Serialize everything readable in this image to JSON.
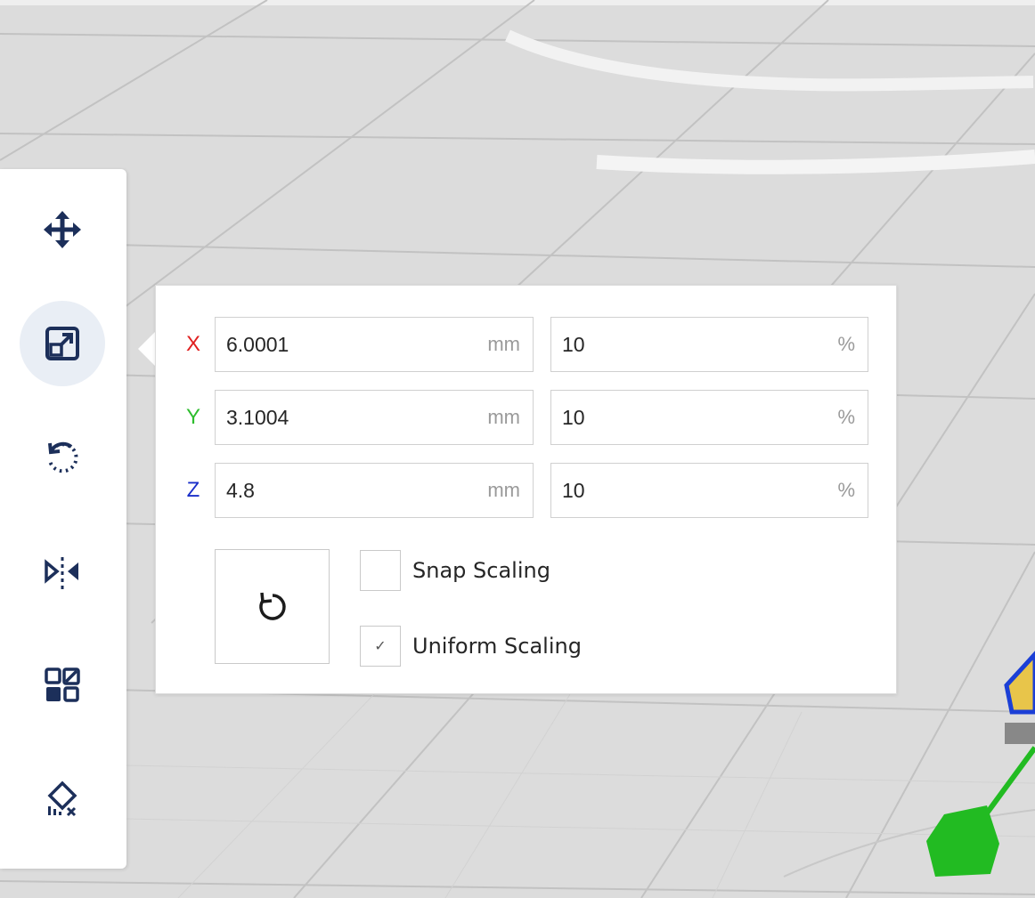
{
  "toolbar": {
    "tools": [
      {
        "name": "move",
        "icon": "move-icon"
      },
      {
        "name": "scale",
        "icon": "scale-icon",
        "active": true
      },
      {
        "name": "rotate",
        "icon": "rotate-icon"
      },
      {
        "name": "mirror",
        "icon": "mirror-icon"
      },
      {
        "name": "per-model-settings",
        "icon": "per-model-settings-icon"
      },
      {
        "name": "support-blocker",
        "icon": "support-blocker-icon"
      }
    ]
  },
  "scale_panel": {
    "rows": [
      {
        "axis": "X",
        "mm_value": "6.0001",
        "mm_unit": "mm",
        "pct_value": "10",
        "pct_unit": "%",
        "color": "#e02020"
      },
      {
        "axis": "Y",
        "mm_value": "3.1004",
        "mm_unit": "mm",
        "pct_value": "10",
        "pct_unit": "%",
        "color": "#2ebd2e"
      },
      {
        "axis": "Z",
        "mm_value": "4.8",
        "mm_unit": "mm",
        "pct_value": "10",
        "pct_unit": "%",
        "color": "#1a2fc9"
      }
    ],
    "snap_scaling": {
      "label": "Snap Scaling",
      "checked": false
    },
    "uniform_scaling": {
      "label": "Uniform Scaling",
      "checked": true,
      "mark": "✓"
    }
  },
  "colors": {
    "accent_active": "#e9eef5",
    "gizmo_green": "#22bb22",
    "selection_blue": "#1b3fd6",
    "model_yellow": "#e8c54a"
  }
}
